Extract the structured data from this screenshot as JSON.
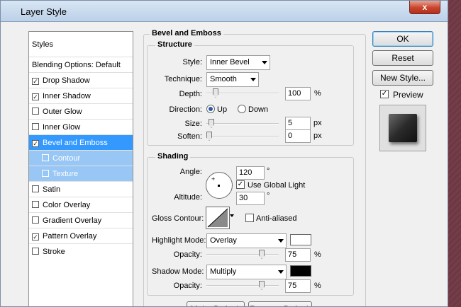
{
  "window": {
    "title": "Layer Style",
    "close": "x"
  },
  "styles_list": {
    "items": [
      {
        "label": "Styles",
        "type": "header"
      },
      {
        "label": "Blending Options: Default",
        "type": "header"
      },
      {
        "label": "Drop Shadow",
        "checked": true
      },
      {
        "label": "Inner Shadow",
        "checked": true
      },
      {
        "label": "Outer Glow",
        "checked": false
      },
      {
        "label": "Inner Glow",
        "checked": false
      },
      {
        "label": "Bevel and Emboss",
        "checked": true,
        "selected": true
      },
      {
        "label": "Contour",
        "checked": false,
        "sub": true
      },
      {
        "label": "Texture",
        "checked": false,
        "sub": true
      },
      {
        "label": "Satin",
        "checked": false
      },
      {
        "label": "Color Overlay",
        "checked": false
      },
      {
        "label": "Gradient Overlay",
        "checked": false
      },
      {
        "label": "Pattern Overlay",
        "checked": true
      },
      {
        "label": "Stroke",
        "checked": false
      }
    ]
  },
  "bevel": {
    "section_title": "Bevel and Emboss",
    "structure": {
      "title": "Structure",
      "style_label": "Style:",
      "style_value": "Inner Bevel",
      "technique_label": "Technique:",
      "technique_value": "Smooth",
      "depth_label": "Depth:",
      "depth_value": "100",
      "depth_unit": "%",
      "direction_label": "Direction:",
      "direction_up": "Up",
      "direction_down": "Down",
      "size_label": "Size:",
      "size_value": "5",
      "size_unit": "px",
      "soften_label": "Soften:",
      "soften_value": "0",
      "soften_unit": "px"
    },
    "shading": {
      "title": "Shading",
      "angle_label": "Angle:",
      "angle_value": "120",
      "angle_unit": "°",
      "use_global_light": "Use Global Light",
      "altitude_label": "Altitude:",
      "altitude_value": "30",
      "altitude_unit": "°",
      "gloss_contour_label": "Gloss Contour:",
      "anti_aliased": "Anti-aliased",
      "highlight_mode_label": "Highlight Mode:",
      "highlight_mode_value": "Overlay",
      "highlight_color": "#ffffff",
      "opacity1_label": "Opacity:",
      "opacity1_value": "75",
      "opacity1_unit": "%",
      "shadow_mode_label": "Shadow Mode:",
      "shadow_mode_value": "Multiply",
      "shadow_color": "#000000",
      "opacity2_label": "Opacity:",
      "opacity2_value": "75",
      "opacity2_unit": "%"
    }
  },
  "buttons": {
    "ok": "OK",
    "reset": "Reset",
    "new_style": "New Style...",
    "preview": "Preview"
  },
  "bottom_buttons": {
    "make_default": "Make Default",
    "reset_default": "Reset to Default"
  },
  "colors": {
    "selection": "#3399ff",
    "sub_selection": "#99c7f5",
    "canvas": "#6e3a45"
  }
}
